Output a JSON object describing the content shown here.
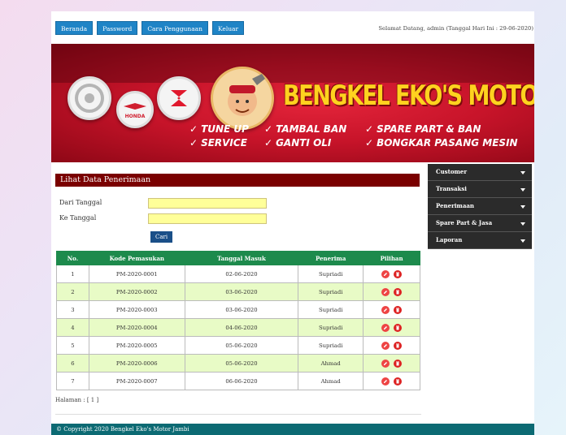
{
  "nav": {
    "items": [
      "Beranda",
      "Password",
      "Cara Penggunaan",
      "Keluar"
    ],
    "welcome": "Selamat Datang, admin (Tanggal Hari Ini : 29-06-2020)"
  },
  "banner": {
    "title": "BENGKEL EKO'S MOTOR JAMBI",
    "honda_text": "HONDA",
    "services": [
      "TUNE UP",
      "TAMBAL BAN",
      "SPARE PART & BAN",
      "SERVICE",
      "GANTI OLI",
      "BONGKAR PASANG MESIN"
    ],
    "check": "✓"
  },
  "sidebar": {
    "items": [
      "Customer",
      "Transaksi",
      "Penerimaan",
      "Spare Part & Jasa",
      "Laporan"
    ]
  },
  "main": {
    "section_title": "Lihat Data Penerimaan",
    "from_label": "Dari Tanggal",
    "to_label": "Ke Tanggal",
    "from_value": "",
    "to_value": "",
    "search_button": "Cari",
    "columns": [
      "No.",
      "Kode Pemasukan",
      "Tanggal Masuk",
      "Penerima",
      "Pilihan"
    ],
    "rows": [
      {
        "no": "1",
        "kode": "PM-2020-0001",
        "tanggal": "02-06-2020",
        "penerima": "Supriadi"
      },
      {
        "no": "2",
        "kode": "PM-2020-0002",
        "tanggal": "03-06-2020",
        "penerima": "Supriadi"
      },
      {
        "no": "3",
        "kode": "PM-2020-0003",
        "tanggal": "03-06-2020",
        "penerima": "Supriadi"
      },
      {
        "no": "4",
        "kode": "PM-2020-0004",
        "tanggal": "04-06-2020",
        "penerima": "Supriadi"
      },
      {
        "no": "5",
        "kode": "PM-2020-0005",
        "tanggal": "05-06-2020",
        "penerima": "Supriadi"
      },
      {
        "no": "6",
        "kode": "PM-2020-0006",
        "tanggal": "05-06-2020",
        "penerima": "Ahmad"
      },
      {
        "no": "7",
        "kode": "PM-2020-0007",
        "tanggal": "06-06-2020",
        "penerima": "Ahmad"
      }
    ],
    "pagination": "Halaman : [ 1 ]"
  },
  "footer": {
    "copyright": "© Copyright 2020 Bengkel Eko's Motor Jambi"
  },
  "colors": {
    "nav_button": "#1f84c6",
    "banner_red": "#c8142a",
    "title_yellow": "#ffd21f",
    "table_header": "#1d8a4c",
    "row_alt": "#e8fbc6",
    "section_title": "#7a0000",
    "footer": "#0c6a73",
    "sidebar": "#2b2b2b"
  },
  "icons": {
    "edit": "pencil-icon",
    "delete": "trash-icon",
    "menu_caret": "caret-down-icon",
    "check": "check-icon"
  }
}
